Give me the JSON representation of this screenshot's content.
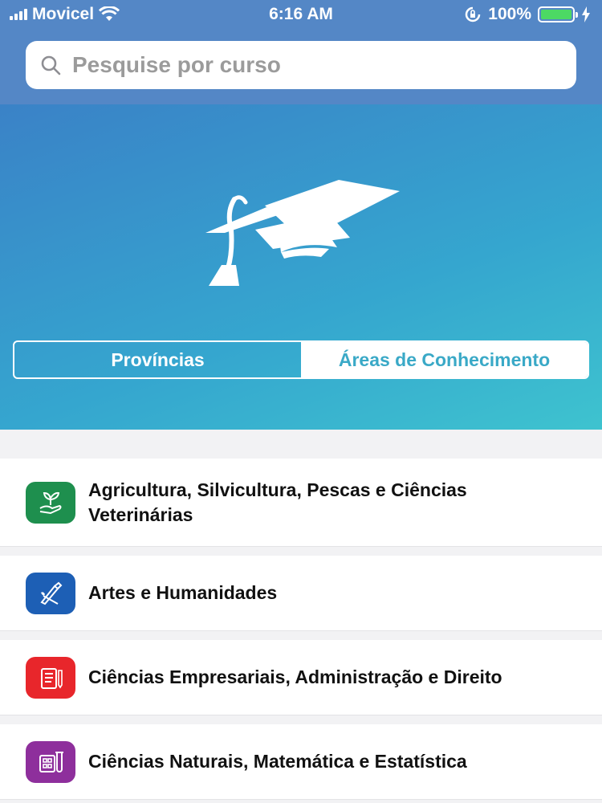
{
  "status_bar": {
    "carrier": "Movicel",
    "time": "6:16 AM",
    "battery": "100%"
  },
  "search": {
    "placeholder": "Pesquise por curso"
  },
  "tabs": [
    {
      "label": "Províncias",
      "selected": false
    },
    {
      "label": "Áreas de Conhecimento",
      "selected": true
    }
  ],
  "areas": [
    {
      "label": "Agricultura, Silvicultura, Pescas e Ciências Veterinárias",
      "icon": "plant-icon",
      "color": "#1e8f4e"
    },
    {
      "label": "Artes e Humanidades",
      "icon": "brush-pencil-icon",
      "color": "#1d5fb5"
    },
    {
      "label": "Ciências Empresariais, Administração e Direito",
      "icon": "notepad-icon",
      "color": "#e8262b"
    },
    {
      "label": "Ciências Naturais, Matemática e Estatística",
      "icon": "lab-icon",
      "color": "#8e2f9c"
    }
  ]
}
